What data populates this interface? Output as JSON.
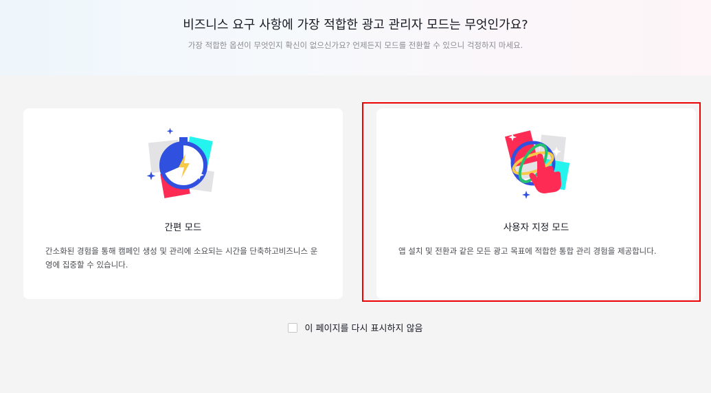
{
  "header": {
    "title": "비즈니스 요구 사항에 가장 적합한 광고 관리자 모드는 무엇인가요?",
    "subtitle": "가장 적합한 옵션이 무엇인지 확신이 없으신가요? 언제든지 모드를 전환할 수 있으니 걱정하지 마세요."
  },
  "cards": [
    {
      "icon": "stopwatch-lightning-icon",
      "title": "간편 모드",
      "description": "간소화된 경험을 통해 캠페인 생성 및 관리에 소요되는 시간을 단축하고비즈니스 운영에 집중할 수 있습니다.",
      "selected": false
    },
    {
      "icon": "globe-hand-icon",
      "title": "사용자 지정 모드",
      "description": "앱 설치 및 전환과 같은 모든 광고 목표에 적합한 통합 관리 경험을 제공합니다.",
      "selected": true
    }
  ],
  "footer": {
    "dont_show_label": "이 페이지를 다시 표시하지 않음",
    "checked": false
  },
  "colors": {
    "highlight": "#ee0000",
    "accent_red": "#fe2c55",
    "accent_cyan": "#25f4ee",
    "accent_blue": "#3050e0"
  }
}
